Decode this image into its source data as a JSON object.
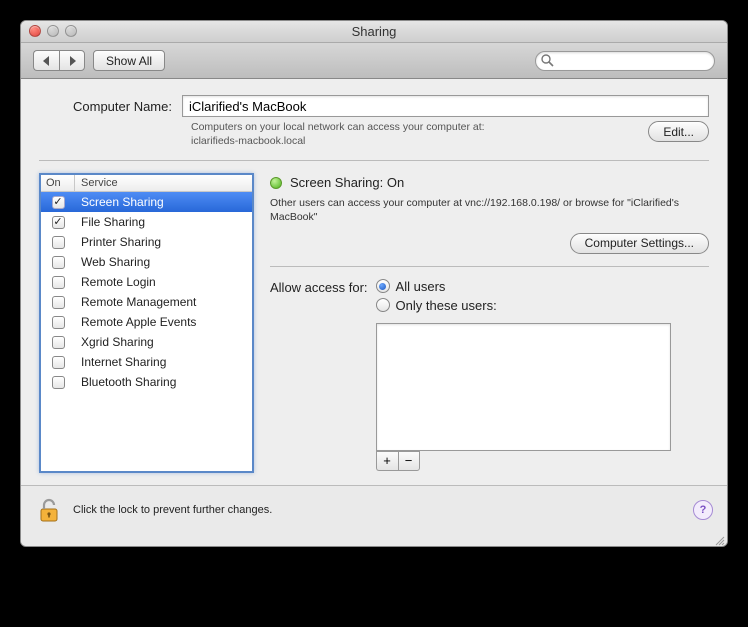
{
  "window": {
    "title": "Sharing"
  },
  "toolbar": {
    "show_all_label": "Show All",
    "search_placeholder": ""
  },
  "computer_name": {
    "label": "Computer Name:",
    "value": "iClarified's MacBook",
    "hint_line1": "Computers on your local network can access your computer at:",
    "hint_line2": "iclarifieds-macbook.local",
    "edit_label": "Edit..."
  },
  "services": {
    "header_on": "On",
    "header_service": "Service",
    "items": [
      {
        "on": true,
        "name": "Screen Sharing",
        "selected": true
      },
      {
        "on": true,
        "name": "File Sharing",
        "selected": false
      },
      {
        "on": false,
        "name": "Printer Sharing",
        "selected": false
      },
      {
        "on": false,
        "name": "Web Sharing",
        "selected": false
      },
      {
        "on": false,
        "name": "Remote Login",
        "selected": false
      },
      {
        "on": false,
        "name": "Remote Management",
        "selected": false
      },
      {
        "on": false,
        "name": "Remote Apple Events",
        "selected": false
      },
      {
        "on": false,
        "name": "Xgrid Sharing",
        "selected": false
      },
      {
        "on": false,
        "name": "Internet Sharing",
        "selected": false
      },
      {
        "on": false,
        "name": "Bluetooth Sharing",
        "selected": false
      }
    ]
  },
  "detail": {
    "status_title": "Screen Sharing: On",
    "status_desc": "Other users can access your computer at vnc://192.168.0.198/ or browse for \"iClarified's MacBook\"",
    "computer_settings_label": "Computer Settings...",
    "access_label": "Allow access for:",
    "radio_all": "All users",
    "radio_only": "Only these users:",
    "radio_selected": "all"
  },
  "lock": {
    "text": "Click the lock to prevent further changes."
  }
}
